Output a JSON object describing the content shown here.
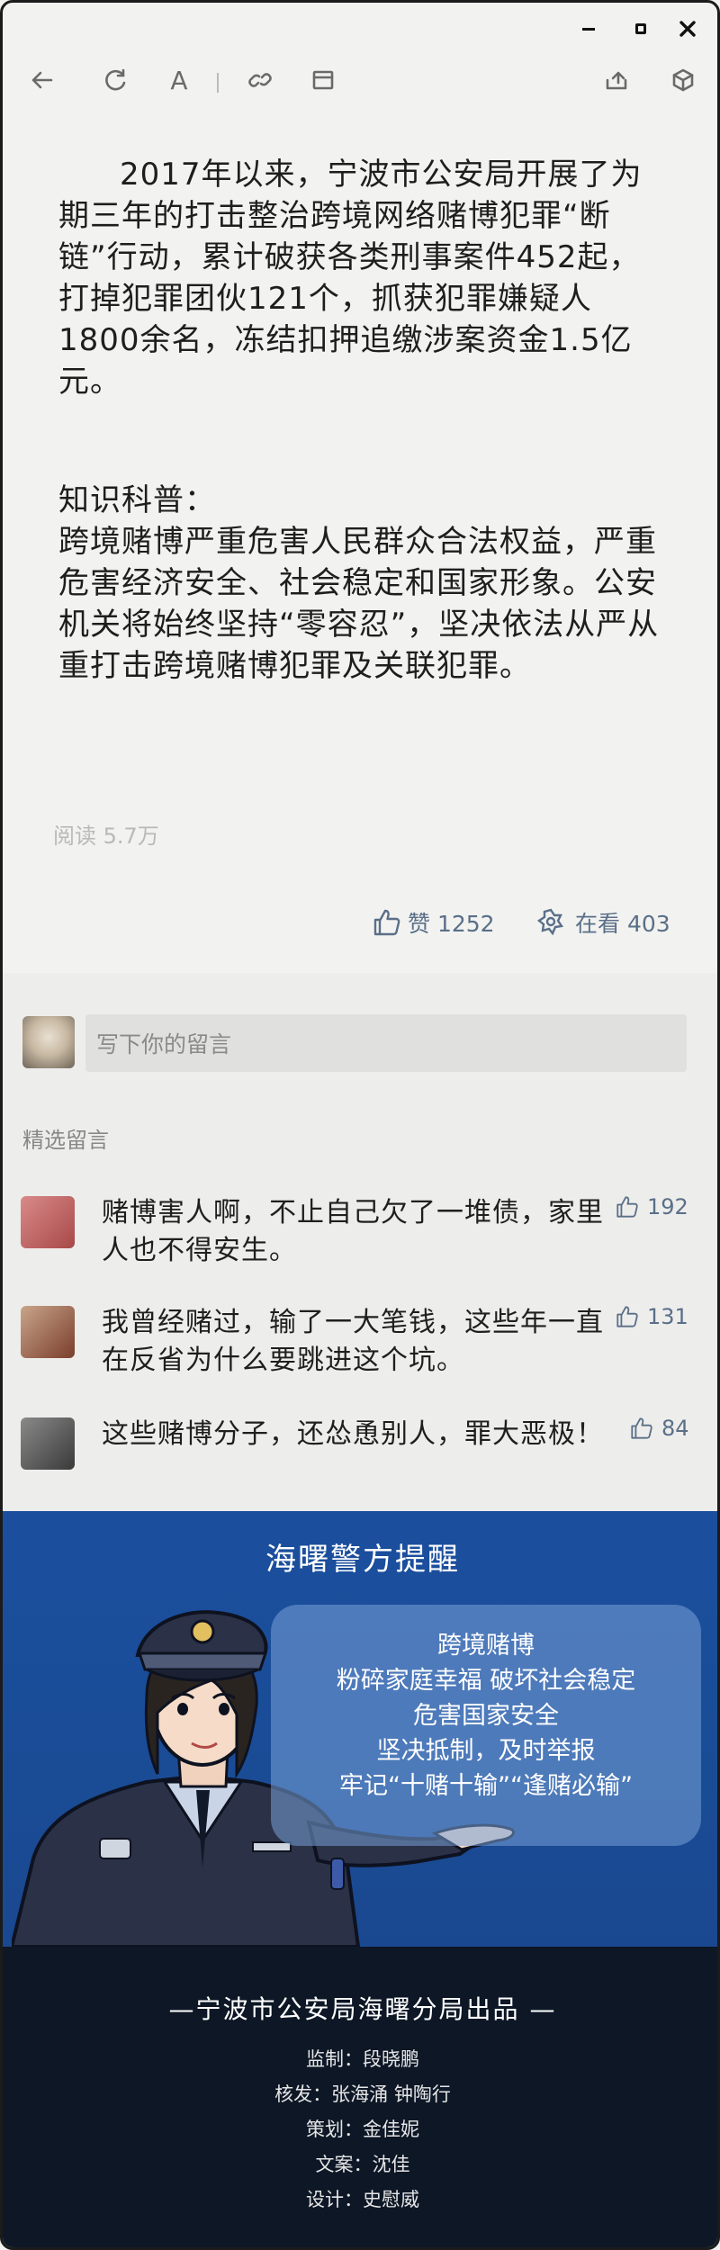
{
  "window": {
    "controls": [
      "minimize-icon",
      "maximize-icon",
      "close-icon"
    ]
  },
  "toolbar": {
    "icons": [
      "back-arrow-icon",
      "refresh-icon",
      "font-size-icon",
      "link-icon",
      "window-icon",
      "share-icon",
      "cube-icon"
    ],
    "font_glyph": "A"
  },
  "article": {
    "paragraph1": "2017年以来，宁波市公安局开展了为期三年的打击整治跨境网络赌博犯罪“断链”行动，累计破获各类刑事案件452起，打掉犯罪团伙121个，抓获犯罪嫌疑人1800余名，冻结扣押追缴涉案资金1.5亿元。",
    "knowledge_title": "知识科普：",
    "knowledge_body": "跨境赌博严重危害人民群众合法权益，严重危害经济安全、社会稳定和国家形象。公安机关将始终坚持“零容忍”，坚决依法从严从重打击跨境赌博犯罪及关联犯罪。",
    "read_count": "阅读 5.7万",
    "likes_label": "赞 1252",
    "watching_label": "在看 403"
  },
  "comments": {
    "input_placeholder": "写下你的留言",
    "featured_label": "精选留言",
    "items": [
      {
        "text": "赌博害人啊，不止自己欠了一堆债，家里人也不得安生。",
        "likes": "192"
      },
      {
        "text": "我曾经赌过，输了一大笔钱，这些年一直在反省为什么要跳进这个坑。",
        "likes": "131"
      },
      {
        "text": "这些赌博分子，还怂恿别人，罪大恶极！",
        "likes": "84"
      }
    ]
  },
  "banner": {
    "title": "海曙警方提醒",
    "lines": [
      "跨境赌博",
      "粉碎家庭幸福 破坏社会稳定",
      "危害国家安全",
      "坚决抵制，及时举报",
      "牢记“十赌十输”“逢赌必输”"
    ],
    "colors": {
      "background": "#1b4f9e",
      "bubble": "#78a0d7"
    }
  },
  "credits": {
    "heading": "—宁波市公安局海曙分局出品 —",
    "lines": [
      "监制：段晓鹏",
      "核发：张海涌 钟陶行",
      "策划：金佳妮",
      "文案：沈佳",
      "设计：史慰威"
    ]
  }
}
